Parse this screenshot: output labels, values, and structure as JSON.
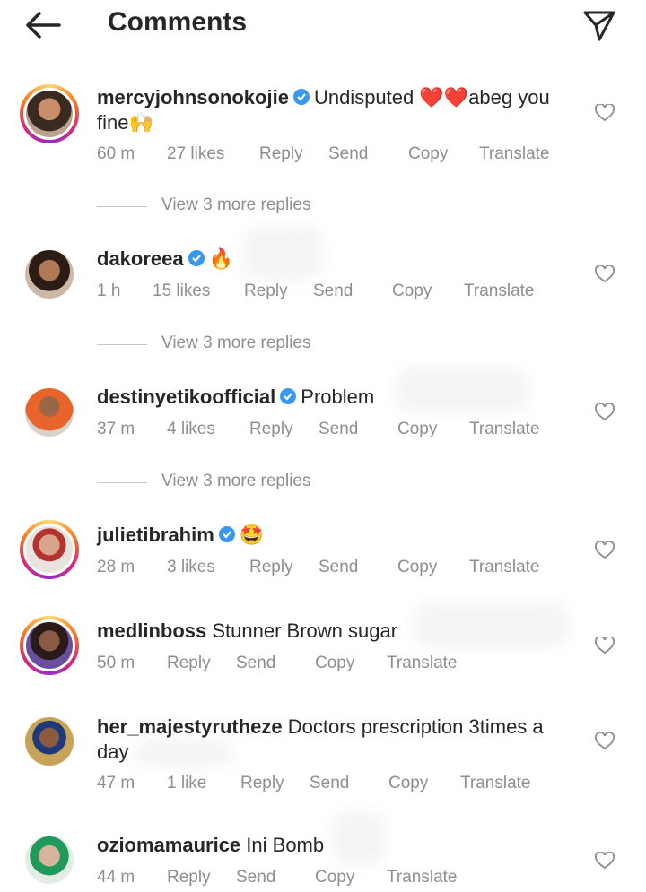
{
  "header": {
    "title": "Comments"
  },
  "comments": [
    {
      "username": "mercyjohnsonokojie",
      "verified": true,
      "text": "Undisputed ❤️❤️abeg you fine🙌",
      "time": "60 m",
      "likes": "27 likes",
      "reply": "Reply",
      "send": "Send",
      "copy": "Copy",
      "translate": "Translate",
      "view_replies": "View 3 more replies"
    },
    {
      "username": "dakoreea",
      "verified": true,
      "text": "🔥",
      "time": "1 h",
      "likes": "15 likes",
      "reply": "Reply",
      "send": "Send",
      "copy": "Copy",
      "translate": "Translate",
      "view_replies": "View 3 more replies"
    },
    {
      "username": "destinyetikoofficial",
      "verified": true,
      "text": "Problem",
      "time": "37 m",
      "likes": "4 likes",
      "reply": "Reply",
      "send": "Send",
      "copy": "Copy",
      "translate": "Translate",
      "view_replies": "View 3 more replies"
    },
    {
      "username": "julietibrahim",
      "verified": true,
      "text": "🤩",
      "time": "28 m",
      "likes": "3 likes",
      "reply": "Reply",
      "send": "Send",
      "copy": "Copy",
      "translate": "Translate"
    },
    {
      "username": "medlinboss",
      "verified": false,
      "text": "Stunner Brown sugar",
      "time": "50 m",
      "reply": "Reply",
      "send": "Send",
      "copy": "Copy",
      "translate": "Translate"
    },
    {
      "username": "her_majestyrutheze",
      "verified": false,
      "text": "Doctors prescription 3times a day",
      "time": "47 m",
      "likes": "1 like",
      "reply": "Reply",
      "send": "Send",
      "copy": "Copy",
      "translate": "Translate"
    },
    {
      "username": "oziomamaurice",
      "verified": false,
      "text": "Ini Bomb",
      "time": "44 m",
      "reply": "Reply",
      "send": "Send",
      "copy": "Copy",
      "translate": "Translate"
    }
  ],
  "colors": {
    "text": "#262626",
    "meta": "#8e8e8e",
    "verified": "#3897f0"
  },
  "icons": {
    "back": "arrow-left-icon",
    "send": "paper-plane-icon",
    "like": "heart-outline-icon",
    "verified": "verified-badge-icon"
  }
}
